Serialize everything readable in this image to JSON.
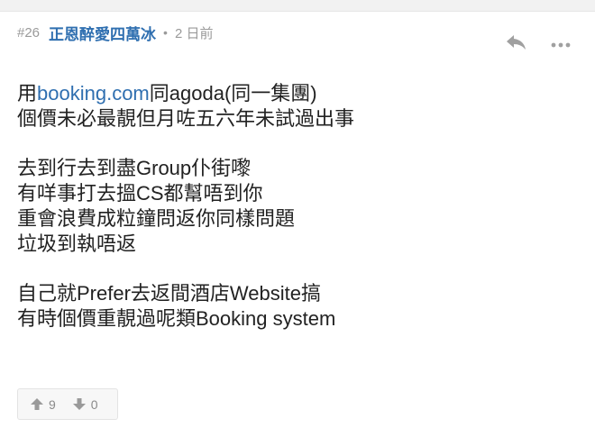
{
  "post": {
    "number": "#26",
    "username": "正恩醉愛四萬冰",
    "separator": "•",
    "time": "2 日前"
  },
  "content": {
    "line1_prefix": "用",
    "line1_link": "booking.com",
    "line1_suffix": "同agoda(同一集團)",
    "line2": "個價未必最靚但月咗五六年未試過出事",
    "line3": "去到行去到盡Group仆街嚟",
    "line4": "有咩事打去搵CS都幫唔到你",
    "line5": "重會浪費成粒鐘問返你同樣問題",
    "line6": "垃圾到執唔返",
    "line7": "自己就Prefer去返間酒店Website搞",
    "line8": "有時個價重靚過呢類Booking system"
  },
  "votes": {
    "up_count": "9",
    "down_count": "0"
  },
  "icons": {
    "reply": "reply-icon",
    "more": "more-dots-icon",
    "upvote": "thumbs-up-icon",
    "downvote": "thumbs-down-icon"
  },
  "colors": {
    "username": "#2f6fb0",
    "link": "#2f6fb0",
    "meta": "#9a9a9a",
    "text": "#222222"
  }
}
